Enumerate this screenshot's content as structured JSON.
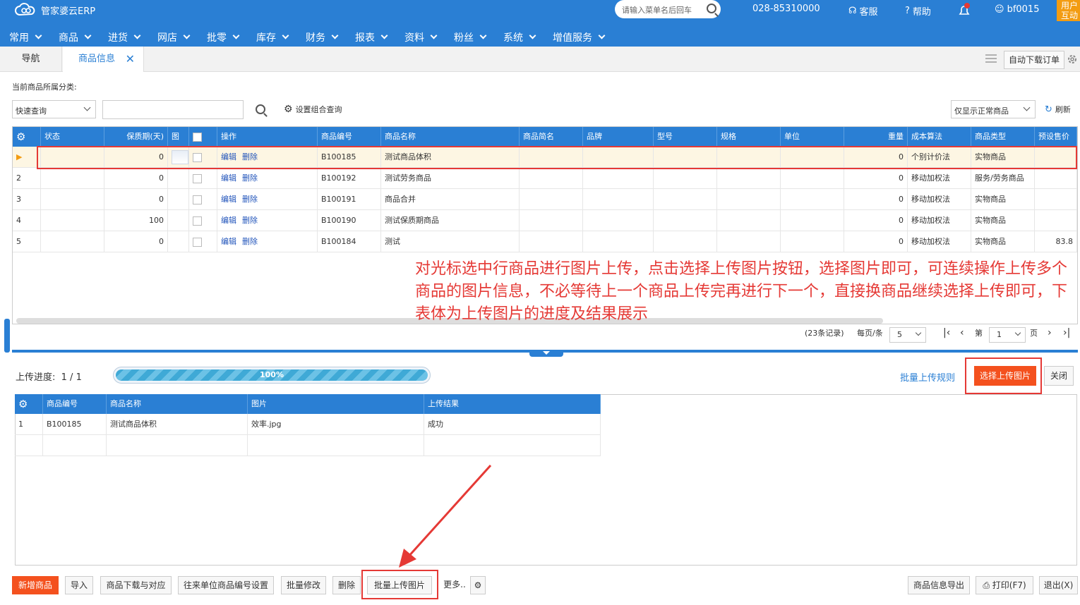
{
  "app": {
    "name": "管家婆云ERP",
    "search_placeholder": "请输入菜单名后回车",
    "phone": "028-85310000",
    "service": "客服",
    "help": "帮助",
    "user": "bf0015",
    "user_btn": "用户互动"
  },
  "menu": [
    "常用",
    "商品",
    "进货",
    "网店",
    "批零",
    "库存",
    "财务",
    "报表",
    "资料",
    "粉丝",
    "系统",
    "增值服务"
  ],
  "tabs": {
    "nav": "导航",
    "active": "商品信息"
  },
  "toolbar": {
    "auto_download": "自动下载订单",
    "category_label": "当前商品所属分类:",
    "quick_query": "快速查询",
    "combo_query": "设置组合查询",
    "filter": "仅显示正常商品",
    "refresh": "刷新"
  },
  "grid": {
    "columns": [
      "状态",
      "保质期(天)",
      "图",
      "",
      "操作",
      "商品编号",
      "商品名称",
      "商品简名",
      "品牌",
      "型号",
      "规格",
      "单位",
      "重量",
      "成本算法",
      "商品类型",
      "预设售价"
    ],
    "edit": "编辑",
    "delete": "删除",
    "rows": [
      {
        "idx": "▶",
        "shelf": "0",
        "code": "B100185",
        "name": "测试商品体积",
        "weight": "0",
        "cost": "个别计价法",
        "type": "实物商品",
        "price": ""
      },
      {
        "idx": "2",
        "shelf": "0",
        "code": "B100192",
        "name": "测试劳务商品",
        "weight": "0",
        "cost": "移动加权法",
        "type": "服务/劳务商品",
        "price": ""
      },
      {
        "idx": "3",
        "shelf": "0",
        "code": "B100191",
        "name": "商品合并",
        "weight": "0",
        "cost": "移动加权法",
        "type": "实物商品",
        "price": ""
      },
      {
        "idx": "4",
        "shelf": "100",
        "code": "B100190",
        "name": "测试保质期商品",
        "weight": "0",
        "cost": "移动加权法",
        "type": "实物商品",
        "price": ""
      },
      {
        "idx": "5",
        "shelf": "0",
        "code": "B100184",
        "name": "测试",
        "weight": "0",
        "cost": "移动加权法",
        "type": "实物商品",
        "price": "83.8"
      }
    ]
  },
  "annotation": "对光标选中行商品进行图片上传，点击选择上传图片按钮，选择图片即可，可连续操作上传多个商品的图片信息，不必等待上一个商品上传完再进行下一个，直接换商品继续选择上传即可，下表体为上传图片的进度及结果展示",
  "pager": {
    "records": "(23条记录)",
    "per_page_label": "每页/条",
    "per_page": "5",
    "page_label": "第",
    "page": "1",
    "page_unit": "页"
  },
  "upload": {
    "label": "上传进度:",
    "count": "1 / 1",
    "progress_text": "100%",
    "progress": 1.0,
    "rule_link": "批量上传规则",
    "select_btn": "选择上传图片",
    "close_btn": "关闭"
  },
  "upload_grid": {
    "columns": [
      "商品编号",
      "商品名称",
      "图片",
      "上传结果"
    ],
    "rows": [
      {
        "idx": "1",
        "code": "B100185",
        "name": "测试商品体积",
        "image": "效率.jpg",
        "result": "成功"
      }
    ]
  },
  "bottom": {
    "new": "新增商品",
    "import": "导入",
    "download": "商品下载与对应",
    "code_setting": "往来单位商品编号设置",
    "batch_edit": "批量修改",
    "delete": "删除",
    "batch_upload": "批量上传图片",
    "more": "更多..",
    "export": "商品信息导出",
    "print": "打印(F7)",
    "exit": "退出(X)"
  },
  "colors": {
    "primary": "#2a7fd4",
    "accent": "#f4511e",
    "annotation": "#e53935"
  }
}
